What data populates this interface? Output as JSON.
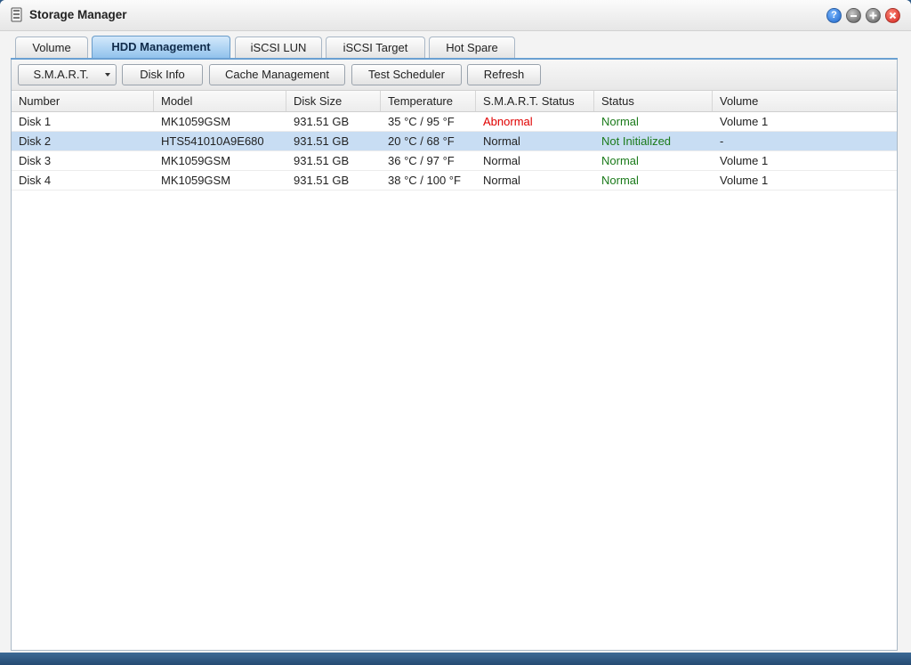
{
  "window": {
    "title": "Storage Manager"
  },
  "tabs": [
    {
      "label": "Volume"
    },
    {
      "label": "HDD Management"
    },
    {
      "label": "iSCSI LUN"
    },
    {
      "label": "iSCSI Target"
    },
    {
      "label": "Hot Spare"
    }
  ],
  "toolbar": {
    "smart_label": "S.M.A.R.T.",
    "disk_info_label": "Disk Info",
    "cache_label": "Cache Management",
    "scheduler_label": "Test Scheduler",
    "refresh_label": "Refresh"
  },
  "table": {
    "columns": [
      "Number",
      "Model",
      "Disk Size",
      "Temperature",
      "S.M.A.R.T. Status",
      "Status",
      "Volume"
    ],
    "rows": [
      [
        "Disk 1",
        "MK1059GSM",
        "931.51 GB",
        "35 °C / 95 °F",
        "Abnormal",
        "Normal",
        "Volume 1"
      ],
      [
        "Disk 2",
        "HTS541010A9E680",
        "931.51 GB",
        "20 °C / 68 °F",
        "Normal",
        "Not Initialized",
        "-"
      ],
      [
        "Disk 3",
        "MK1059GSM",
        "931.51 GB",
        "36 °C / 97 °F",
        "Normal",
        "Normal",
        "Volume 1"
      ],
      [
        "Disk 4",
        "MK1059GSM",
        "931.51 GB",
        "38 °C / 100 °F",
        "Normal",
        "Normal",
        "Volume 1"
      ]
    ]
  },
  "colors": {
    "abnormal": "#e00000",
    "status_ok": "#1a7a1a",
    "selected_row": "#c8ddf3",
    "active_tab": "#8fc1ec"
  },
  "icons": {
    "app": "storage-manager-icon",
    "help": "help-icon",
    "minimize": "minimize-icon",
    "maximize": "maximize-icon",
    "close": "close-icon",
    "dropdown": "chevron-down-icon"
  }
}
